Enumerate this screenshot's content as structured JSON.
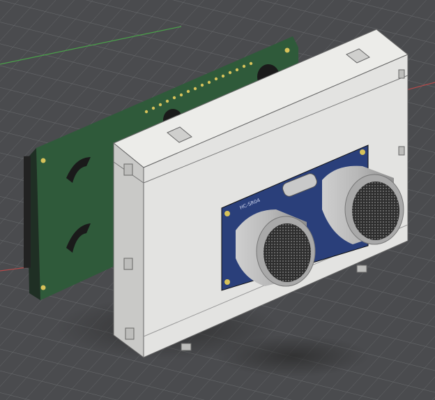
{
  "scene": {
    "description_visible_text": {
      "sensor_label": "HC-SR04"
    },
    "icons": {
      "model": "3d-cad-model-icon"
    },
    "colors": {
      "background": "#4a4b4e",
      "grid_line": "#6b6d70",
      "axis_x": "#b24a4a",
      "axis_y": "#4aa04a",
      "enclosure_face": "#e3e3e1",
      "enclosure_side": "#c9c9c7",
      "pcb_green": "#2f5a3a",
      "pcb_blue": "#2a3f7a",
      "transducer": "#b9b9b9",
      "mesh": "#3a3a3a"
    }
  }
}
